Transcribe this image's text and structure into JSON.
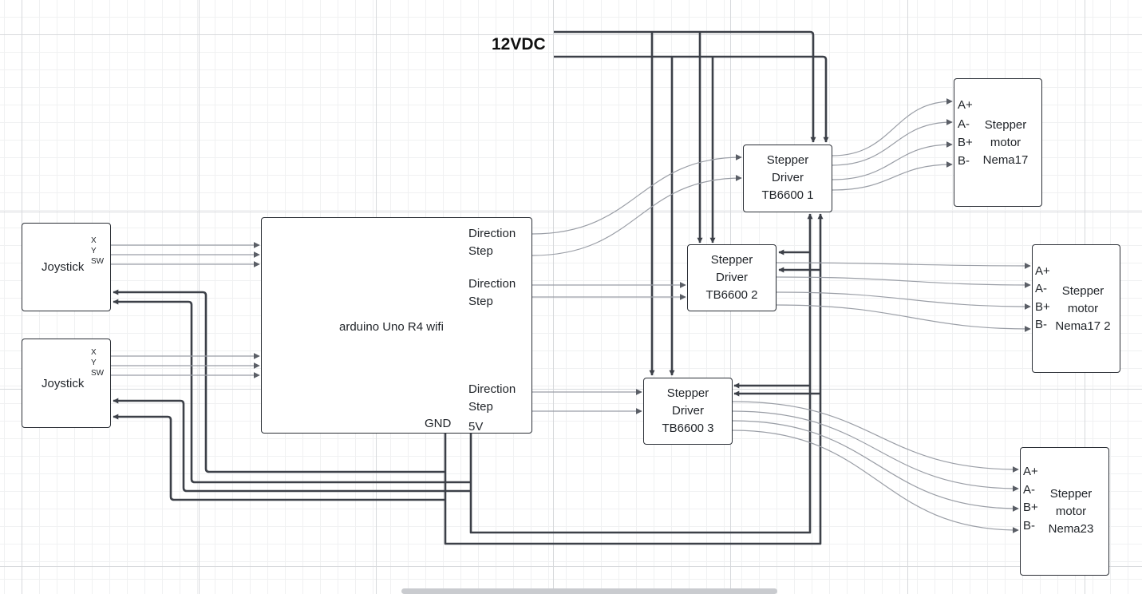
{
  "power": {
    "label": "12VDC"
  },
  "joysticks": [
    {
      "label": "Joystick",
      "pins": [
        "X",
        "Y",
        "SW"
      ]
    },
    {
      "label": "Joystick",
      "pins": [
        "X",
        "Y",
        "SW"
      ]
    }
  ],
  "arduino": {
    "label": "arduino Uno R4 wifi",
    "outputs": [
      {
        "direction": "Direction",
        "step": "Step"
      },
      {
        "direction": "Direction",
        "step": "Step"
      },
      {
        "direction": "Direction",
        "step": "Step"
      }
    ],
    "gnd": "GND",
    "v5": "5V"
  },
  "drivers": [
    {
      "line1": "Stepper",
      "line2": "Driver",
      "line3": "TB6600 1"
    },
    {
      "line1": "Stepper",
      "line2": "Driver",
      "line3": "TB6600 2"
    },
    {
      "line1": "Stepper",
      "line2": "Driver",
      "line3": "TB6600 3"
    }
  ],
  "motors": [
    {
      "pins": [
        "A+",
        "A-",
        "B+",
        "B-"
      ],
      "line1": "Stepper",
      "line2": "motor",
      "line3": "Nema17"
    },
    {
      "pins": [
        "A+",
        "A-",
        "B+",
        "B-"
      ],
      "line1": "Stepper",
      "line2": "motor",
      "line3": "Nema17 2"
    },
    {
      "pins": [
        "A+",
        "A-",
        "B+",
        "B-"
      ],
      "line1": "Stepper",
      "line2": "motor",
      "line3": "Nema23"
    }
  ],
  "colors": {
    "bus": "#3c4048",
    "signal": "#9a9ea6",
    "border": "#2b2f36"
  }
}
